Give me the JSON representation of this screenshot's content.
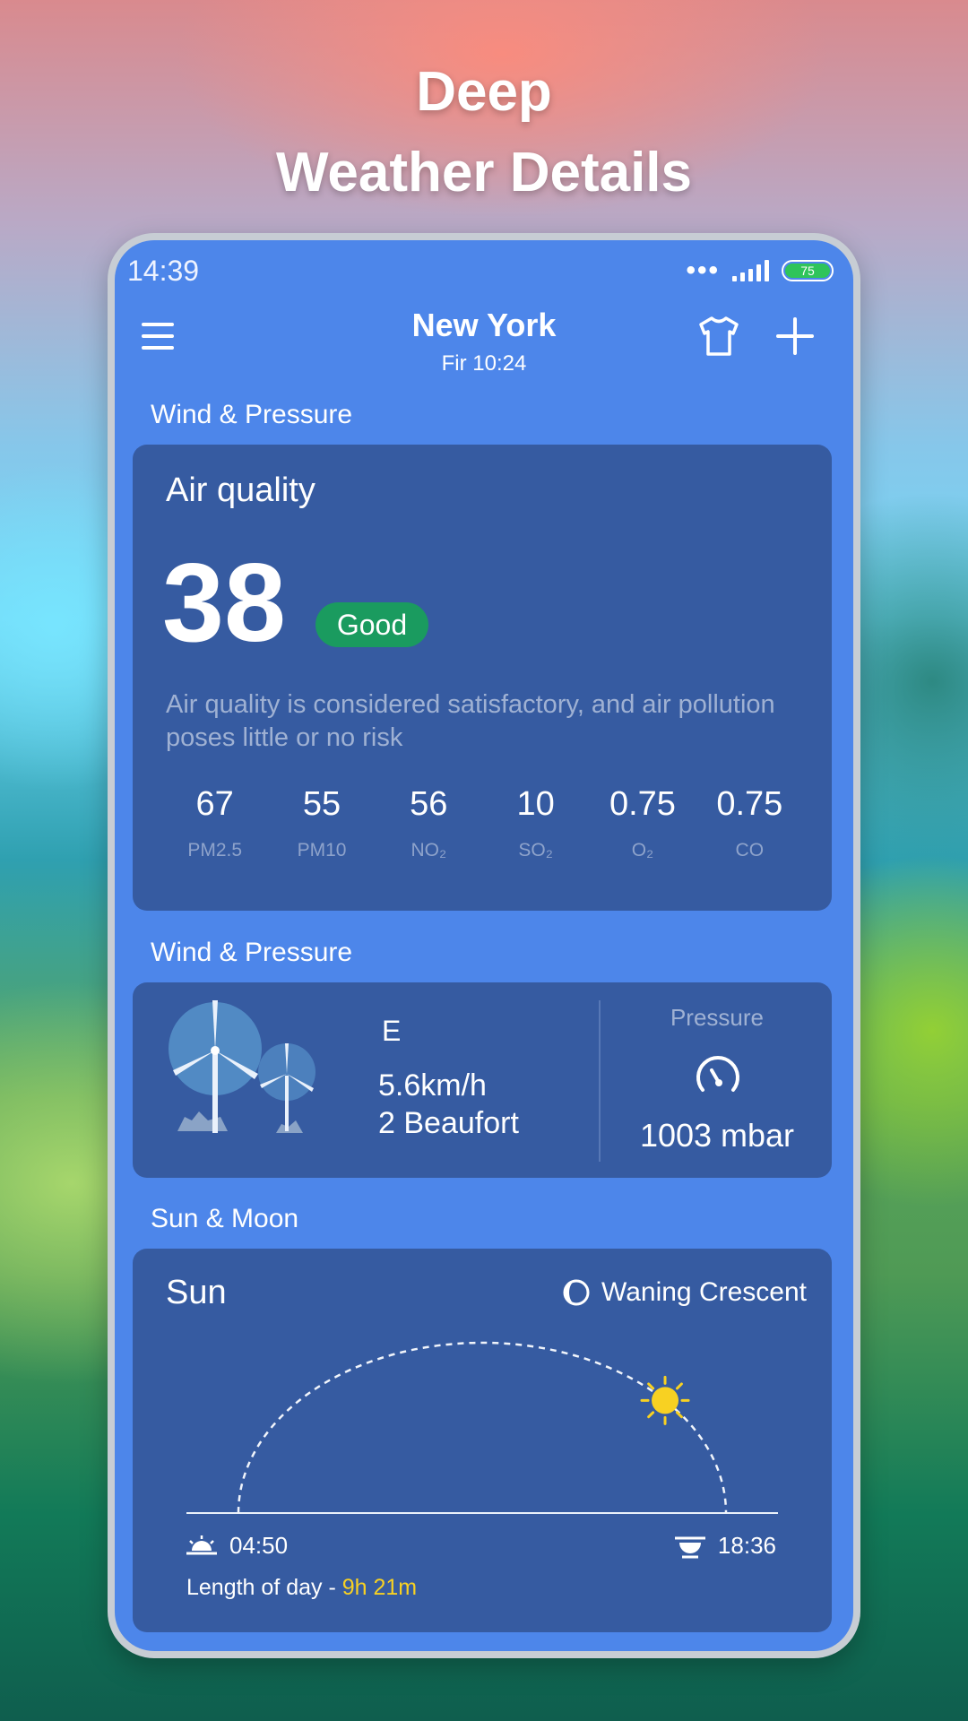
{
  "promo": {
    "line1": "Deep",
    "line2": "Weather Details"
  },
  "status_bar": {
    "time": "14:39",
    "battery": "75",
    "battery_color": "#2fc45a"
  },
  "header": {
    "city": "New York",
    "datetime": "Fir 10:24"
  },
  "air_quality_section": {
    "section_title": "Wind & Pressure",
    "card_title": "Air quality",
    "value": "38",
    "badge": "Good",
    "badge_color": "#1a9b5f",
    "description": "Air quality is considered satisfactory, and air pollution poses little or no risk",
    "pollutants": [
      {
        "value": "67",
        "label": "PM2.5"
      },
      {
        "value": "55",
        "label": "PM10"
      },
      {
        "value": "56",
        "label": "NO₂"
      },
      {
        "value": "10",
        "label": "SO₂"
      },
      {
        "value": "0.75",
        "label": "O₂"
      },
      {
        "value": "0.75",
        "label": "CO"
      }
    ]
  },
  "wind_section": {
    "section_title": "Wind & Pressure",
    "direction": "E",
    "speed": "5.6km/h",
    "beaufort": "2 Beaufort",
    "pressure_label": "Pressure",
    "pressure_value": "1003 mbar"
  },
  "sun_section": {
    "section_title": "Sun & Moon",
    "card_title": "Sun",
    "moon_phase": "Waning Crescent",
    "sunrise": "04:50",
    "sunset": "18:36",
    "day_length_label": "Length of day -",
    "day_length_value": "9h 21m",
    "sun_color": "#f8d122",
    "sun_progress": 0.77
  },
  "icons": [
    "menu-icon",
    "shirt-icon",
    "plus-icon",
    "wind-turbine-icon",
    "gauge-icon",
    "moon-icon",
    "sunrise-icon",
    "sunset-icon",
    "sun-icon"
  ]
}
